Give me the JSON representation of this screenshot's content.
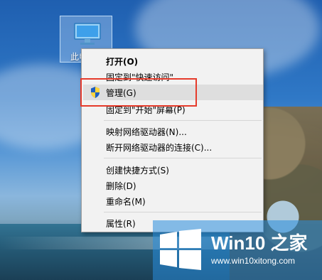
{
  "desktop": {
    "icon_label": "此电脑"
  },
  "context_menu": {
    "items": [
      {
        "label": "打开(O)",
        "bold": true
      },
      {
        "label": "固定到\"快速访问\""
      },
      {
        "label": "管理(G)",
        "icon": "uac-shield-icon",
        "hover": true
      },
      {
        "label": "固定到\"开始\"屏幕(P)"
      },
      {
        "label": "映射网络驱动器(N)..."
      },
      {
        "label": "断开网络驱动器的连接(C)..."
      },
      {
        "label": "创建快捷方式(S)"
      },
      {
        "label": "删除(D)"
      },
      {
        "label": "重命名(M)"
      },
      {
        "label": "属性(R)"
      }
    ]
  },
  "watermark": {
    "title": "Win10 之家",
    "url": "www.win10xitong.com",
    "logo_icon": "windows-logo-icon"
  },
  "colors": {
    "highlight": "#e53b2b",
    "menu_background": "#f2f2f2",
    "menu_hover": "#dedede",
    "watermark_bg": "#2c8cdc"
  }
}
